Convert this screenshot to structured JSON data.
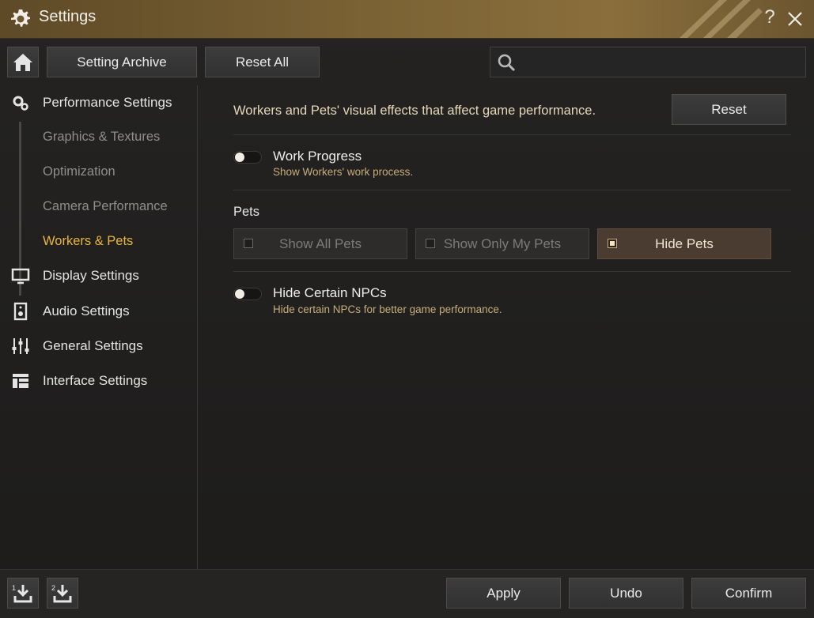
{
  "window": {
    "title": "Settings"
  },
  "toolbar": {
    "archive_label": "Setting Archive",
    "reset_all_label": "Reset All",
    "search_placeholder": ""
  },
  "sidebar": {
    "performance": {
      "label": "Performance Settings",
      "subitems": [
        "Graphics & Textures",
        "Optimization",
        "Camera Performance",
        "Workers & Pets"
      ],
      "active_index": 3
    },
    "items": [
      {
        "label": "Display Settings",
        "icon": "monitor-icon"
      },
      {
        "label": "Audio Settings",
        "icon": "speaker-icon"
      },
      {
        "label": "General Settings",
        "icon": "sliders-icon"
      },
      {
        "label": "Interface Settings",
        "icon": "layout-icon"
      }
    ]
  },
  "content": {
    "description": "Workers and Pets' visual effects that affect game performance.",
    "reset_label": "Reset",
    "work_progress": {
      "title": "Work Progress",
      "subtitle": "Show Workers' work process.",
      "enabled": false
    },
    "pets": {
      "label": "Pets",
      "options": [
        "Show All Pets",
        "Show Only My Pets",
        "Hide Pets"
      ],
      "selected": "Hide Pets"
    },
    "hide_npcs": {
      "title": "Hide Certain NPCs",
      "subtitle": "Hide certain NPCs for better game performance.",
      "enabled": false
    }
  },
  "footer": {
    "save_slot_1": "1",
    "save_slot_2": "2",
    "apply_label": "Apply",
    "undo_label": "Undo",
    "confirm_label": "Confirm"
  },
  "colors": {
    "accent": "#e8b53a",
    "title_bar": "#7a6234",
    "selected_option": "#4a3c30"
  }
}
